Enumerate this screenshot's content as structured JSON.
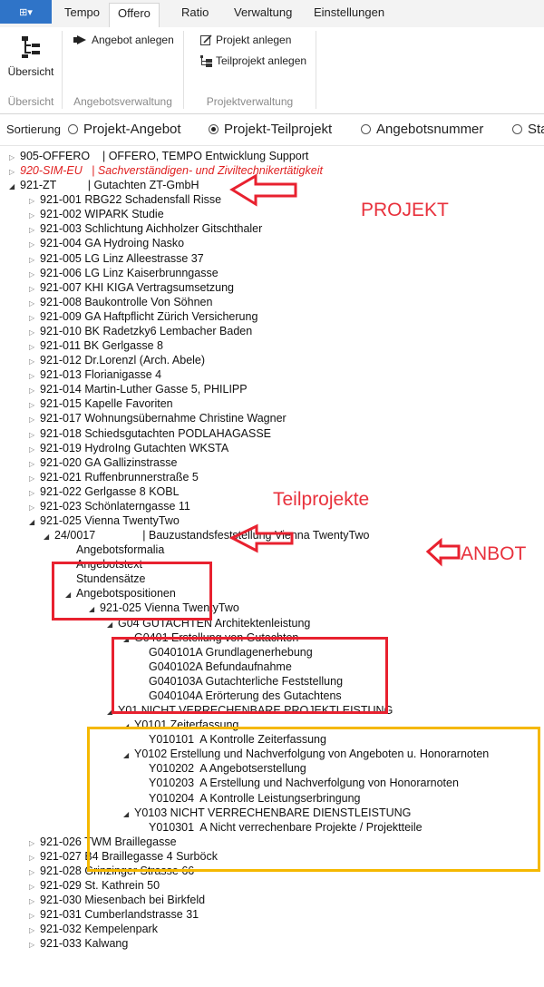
{
  "ribbon": {
    "app_button": "⊞▾",
    "tabs": [
      "Tempo",
      "Offero",
      "Ratio",
      "Verwaltung",
      "Einstellungen"
    ],
    "active_tab": "Offero",
    "groups": {
      "uebersicht": {
        "button": "Übersicht",
        "label": "Übersicht"
      },
      "angebotsverwaltung": {
        "button": "Angebot anlegen",
        "label": "Angebotsverwaltung"
      },
      "projektverwaltung": {
        "button1": "Projekt anlegen",
        "button2": "Teilprojekt anlegen",
        "label": "Projektverwaltung"
      }
    }
  },
  "sort": {
    "label": "Sortierung",
    "options": [
      "Projekt-Angebot",
      "Projekt-Teilprojekt",
      "Angebotsnummer",
      "Sta"
    ],
    "selected": "Projekt-Teilprojekt"
  },
  "tree": [
    {
      "text": "905-OFFERO    | OFFERO, TEMPO Entwicklung Support",
      "level": 0,
      "state": "closed"
    },
    {
      "text": "920-SIM-EU   | Sachverständigen- und Ziviltechnikertätigkeit",
      "level": 0,
      "state": "closed",
      "style": "red"
    },
    {
      "text": "921-ZT          | Gutachten ZT-GmbH",
      "level": 0,
      "state": "open"
    },
    {
      "text": "921-001 RBG22 Schadensfall Risse",
      "level": 1,
      "state": "closed"
    },
    {
      "text": "921-002 WIPARK Studie",
      "level": 1,
      "state": "closed"
    },
    {
      "text": "921-003 Schlichtung Aichholzer Gitschthaler",
      "level": 1,
      "state": "closed"
    },
    {
      "text": "921-004 GA Hydroing Nasko",
      "level": 1,
      "state": "closed"
    },
    {
      "text": "921-005 LG Linz Alleestrasse 37",
      "level": 1,
      "state": "closed"
    },
    {
      "text": "921-006 LG Linz Kaiserbrunngasse",
      "level": 1,
      "state": "closed"
    },
    {
      "text": "921-007 KHI KIGA Vertragsumsetzung",
      "level": 1,
      "state": "closed"
    },
    {
      "text": "921-008 Baukontrolle Von Söhnen",
      "level": 1,
      "state": "closed"
    },
    {
      "text": "921-009 GA Haftpflicht Zürich Versicherung",
      "level": 1,
      "state": "closed"
    },
    {
      "text": "921-010 BK Radetzky6 Lembacher Baden",
      "level": 1,
      "state": "closed"
    },
    {
      "text": "921-011 BK Gerlgasse 8",
      "level": 1,
      "state": "closed"
    },
    {
      "text": "921-012 Dr.Lorenzl (Arch. Abele)",
      "level": 1,
      "state": "closed"
    },
    {
      "text": "921-013 Florianigasse 4",
      "level": 1,
      "state": "closed"
    },
    {
      "text": "921-014 Martin-Luther Gasse 5, PHILIPP",
      "level": 1,
      "state": "closed"
    },
    {
      "text": "921-015 Kapelle Favoriten",
      "level": 1,
      "state": "closed"
    },
    {
      "text": "921-017 Wohnungsübernahme Christine Wagner",
      "level": 1,
      "state": "closed"
    },
    {
      "text": "921-018 Schiedsgutachten PODLAHAGASSE",
      "level": 1,
      "state": "closed"
    },
    {
      "text": "921-019 HydroIng Gutachten WKSTA",
      "level": 1,
      "state": "closed"
    },
    {
      "text": "921-020 GA Gallizinstrasse",
      "level": 1,
      "state": "closed"
    },
    {
      "text": "921-021 Ruffenbrunnerstraße 5",
      "level": 1,
      "state": "closed"
    },
    {
      "text": "921-022 Gerlgasse 8 KOBL",
      "level": 1,
      "state": "closed"
    },
    {
      "text": "921-023 Schönlaterngasse 11",
      "level": 1,
      "state": "closed"
    },
    {
      "text": "921-025 Vienna TwentyTwo",
      "level": 1,
      "state": "open"
    },
    {
      "text": "24/0017               | Bauzustandsfeststellung Vienna TwentyTwo",
      "level": 2,
      "state": "open"
    },
    {
      "text": "Angebotsformalia",
      "level": 3,
      "state": "none"
    },
    {
      "text": "Angebotstext",
      "level": 3,
      "state": "none"
    },
    {
      "text": "Stundensätze",
      "level": 3,
      "state": "none"
    },
    {
      "text": "Angebotspositionen",
      "level": 3,
      "state": "open"
    },
    {
      "text": "921-025 Vienna TwentyTwo",
      "level": 4,
      "state": "open"
    },
    {
      "text": "G04 GUTACHTEN Architektenleistung",
      "level": 5,
      "state": "open"
    },
    {
      "text": "G0401 Erstellung von Gutachten",
      "level": 6,
      "state": "open"
    },
    {
      "text": "G040101A Grundlagenerhebung",
      "level": 7,
      "state": "none"
    },
    {
      "text": "G040102A Befundaufnahme",
      "level": 7,
      "state": "none"
    },
    {
      "text": "G040103A Gutachterliche Feststellung",
      "level": 7,
      "state": "none"
    },
    {
      "text": "G040104A Erörterung des Gutachtens",
      "level": 7,
      "state": "none"
    },
    {
      "text": "Y01 NICHT VERRECHENBARE PROJEKTLEISTUNG",
      "level": 5,
      "state": "open"
    },
    {
      "text": "Y0101 Zeiterfassung",
      "level": 6,
      "state": "open"
    },
    {
      "text": "Y010101  A Kontrolle Zeiterfassung",
      "level": 7,
      "state": "none"
    },
    {
      "text": "Y0102 Erstellung und Nachverfolgung von Angeboten u. Honorarnoten",
      "level": 6,
      "state": "open"
    },
    {
      "text": "Y010202  A Angebotserstellung",
      "level": 7,
      "state": "none"
    },
    {
      "text": "Y010203  A Erstellung und Nachverfolgung von Honorarnoten",
      "level": 7,
      "state": "none"
    },
    {
      "text": "Y010204  A Kontrolle Leistungserbringung",
      "level": 7,
      "state": "none"
    },
    {
      "text": "Y0103 NICHT VERRECHENBARE DIENSTLEISTUNG",
      "level": 6,
      "state": "open"
    },
    {
      "text": "Y010301  A Nicht verrechenbare Projekte / Projektteile",
      "level": 7,
      "state": "none"
    },
    {
      "text": "921-026 TWM Braillegasse",
      "level": 1,
      "state": "closed"
    },
    {
      "text": "921-027 B4 Braillegasse 4 Surböck",
      "level": 1,
      "state": "closed"
    },
    {
      "text": "921-028 Grinzinger Strasse 66",
      "level": 1,
      "state": "closed"
    },
    {
      "text": "921-029 St. Kathrein 50",
      "level": 1,
      "state": "closed"
    },
    {
      "text": "921-030 Miesenbach bei Birkfeld",
      "level": 1,
      "state": "closed"
    },
    {
      "text": "921-031 Cumberlandstrasse 31",
      "level": 1,
      "state": "closed"
    },
    {
      "text": "921-032 Kempelenpark",
      "level": 1,
      "state": "closed"
    },
    {
      "text": "921-033 Kalwang",
      "level": 1,
      "state": "closed"
    }
  ],
  "annotations": {
    "projekt": "PROJEKT",
    "teilprojekte": "Teilprojekte",
    "anbot": "ANBOT"
  },
  "colors": {
    "annotation_red": "#e8212f",
    "annotation_yellow": "#f5b800",
    "accent_blue": "#2f74c8"
  }
}
